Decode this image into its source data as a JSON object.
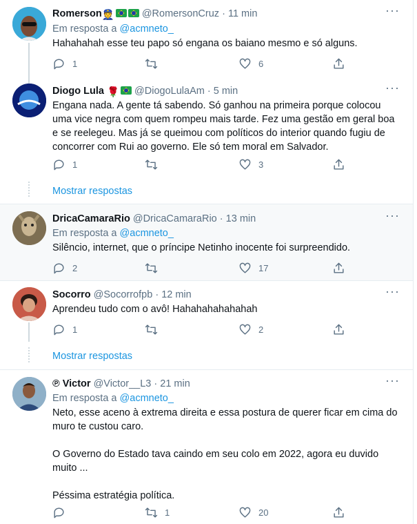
{
  "tweets": [
    {
      "name": "Romerson",
      "extra": "👮",
      "handle": "@RomersonCruz",
      "time": "11 min",
      "reply_prefix": "Em resposta a",
      "reply_to": "@acmneto_",
      "text": [
        "Hahahahah esse teu papo só engana os baiano mesmo e só alguns."
      ],
      "replies": "1",
      "retweets": "",
      "likes": "6"
    },
    {
      "name": "Diogo Lula",
      "extra": "🌹",
      "handle": "@DiogoLulaAm",
      "time": "5 min",
      "text": [
        "Engana nada. A gente tá sabendo. Só ganhou na primeira porque colocou",
        "uma vice negra com quem rompeu mais tarde. Fez uma gestão em geral boa",
        "e se reelegeu. Mas já se queimou com políticos do interior quando fugiu de",
        "concorrer com Rui ao governo. Ele só tem moral em Salvador."
      ],
      "replies": "1",
      "retweets": "",
      "likes": "3",
      "show_replies": "Mostrar respostas"
    },
    {
      "name": "DricaCamaraRio",
      "handle": "@DricaCamaraRio",
      "time": "13 min",
      "reply_prefix": "Em resposta a",
      "reply_to": "@acmneto_",
      "text": [
        "Silêncio, internet, que o príncipe Netinho inocente foi surpreendido."
      ],
      "replies": "2",
      "retweets": "",
      "likes": "17"
    },
    {
      "name": "Socorro",
      "handle": "@Socorrofpb",
      "time": "12 min",
      "text": [
        "Aprendeu tudo com o avô! Hahahahahahahah"
      ],
      "replies": "1",
      "retweets": "",
      "likes": "2",
      "show_replies": "Mostrar respostas"
    },
    {
      "name": "℗ Victor",
      "handle": "@Victor__L3",
      "time": "21 min",
      "reply_prefix": "Em resposta a",
      "reply_to": "@acmneto_",
      "text": [
        "Neto, esse aceno à extrema direita e essa postura de querer ficar em cima do",
        "muro te custou caro.",
        "",
        "O Governo do Estado tava caindo em seu colo em 2022,  agora eu duvido",
        "muito ...",
        "",
        "Péssima estratégia política."
      ],
      "replies": "",
      "retweets": "1",
      "likes": "20"
    }
  ],
  "separator": "·",
  "colors": {
    "accent": "#1b95e0",
    "meta": "#5b7083",
    "highlight": "#f7f9fa"
  }
}
